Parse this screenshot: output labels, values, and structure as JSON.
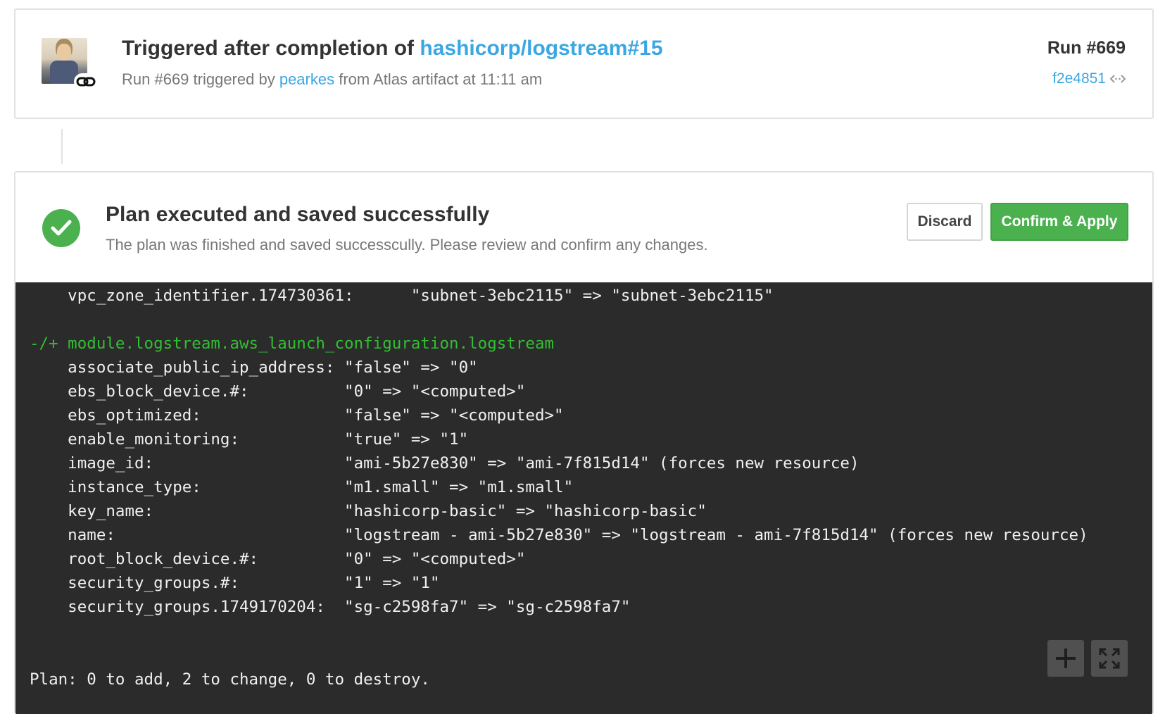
{
  "run": {
    "title_prefix": "Triggered after completion of",
    "title_link": "hashicorp/logstream#15",
    "sub_prefix": "Run #669 triggered by",
    "sub_user": "pearkes",
    "sub_suffix": "from Atlas artifact at 11:11 am",
    "number": "Run #669",
    "commit": "f2e4851",
    "avatar_icon": "user-avatar",
    "badge_icon": "chain-link-icon",
    "commit_icon": "code-icon"
  },
  "plan": {
    "status_icon": "checkmark-icon",
    "title": "Plan executed and saved successfully",
    "subtitle": "The plan was finished and saved successcully. Please review and confirm any changes.",
    "discard_label": "Discard",
    "confirm_label": "Confirm & Apply",
    "colors": {
      "success": "#4bb14f",
      "link": "#3aa7e3",
      "terminal_bg": "#2b2b2b",
      "terminal_green": "#30c030"
    }
  },
  "terminal": {
    "lines": [
      {
        "text": "    vpc_zone_identifier.174730361:      \"subnet-3ebc2115\" => \"subnet-3ebc2115\"",
        "color": "default"
      },
      {
        "text": "",
        "color": "default"
      },
      {
        "text": "-/+ module.logstream.aws_launch_configuration.logstream",
        "color": "green"
      },
      {
        "text": "    associate_public_ip_address: \"false\" => \"0\"",
        "color": "default"
      },
      {
        "text": "    ebs_block_device.#:          \"0\" => \"<computed>\"",
        "color": "default"
      },
      {
        "text": "    ebs_optimized:               \"false\" => \"<computed>\"",
        "color": "default"
      },
      {
        "text": "    enable_monitoring:           \"true\" => \"1\"",
        "color": "default"
      },
      {
        "text": "    image_id:                    \"ami-5b27e830\" => \"ami-7f815d14\" (forces new resource)",
        "color": "default"
      },
      {
        "text": "    instance_type:               \"m1.small\" => \"m1.small\"",
        "color": "default"
      },
      {
        "text": "    key_name:                    \"hashicorp-basic\" => \"hashicorp-basic\"",
        "color": "default"
      },
      {
        "text": "    name:                        \"logstream - ami-5b27e830\" => \"logstream - ami-7f815d14\" (forces new resource)",
        "color": "default"
      },
      {
        "text": "    root_block_device.#:         \"0\" => \"<computed>\"",
        "color": "default"
      },
      {
        "text": "    security_groups.#:           \"1\" => \"1\"",
        "color": "default"
      },
      {
        "text": "    security_groups.1749170204:  \"sg-c2598fa7\" => \"sg-c2598fa7\"",
        "color": "default"
      }
    ],
    "summary": "Plan: 0 to add, 2 to change, 0 to destroy.",
    "expand_icon": "plus-icon",
    "fullscreen_icon": "fullscreen-icon"
  }
}
